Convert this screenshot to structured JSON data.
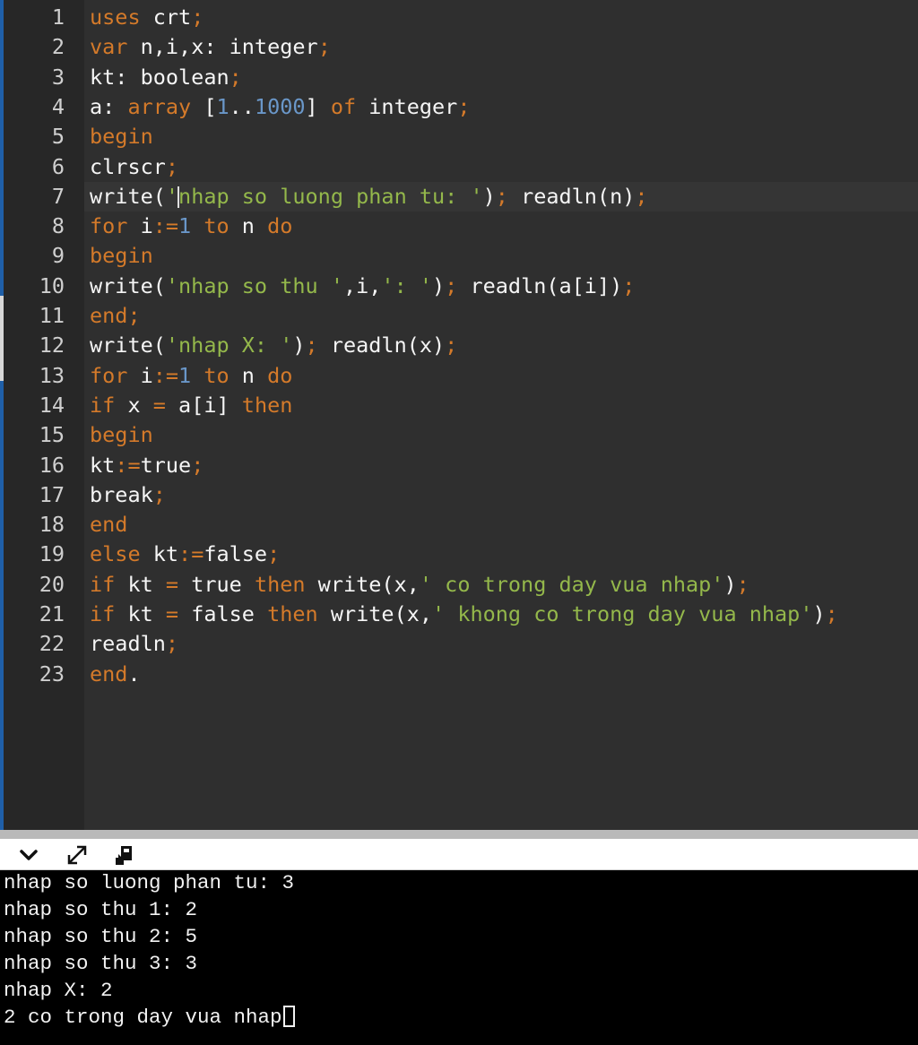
{
  "editor": {
    "line_numbers": [
      "1",
      "2",
      "3",
      "4",
      "5",
      "6",
      "7",
      "8",
      "9",
      "10",
      "11",
      "12",
      "13",
      "14",
      "15",
      "16",
      "17",
      "18",
      "19",
      "20",
      "21",
      "22",
      "23"
    ],
    "active_line": 7,
    "lines": [
      [
        [
          "kw",
          "uses"
        ],
        [
          "id",
          " crt"
        ],
        [
          "pn",
          ";"
        ]
      ],
      [
        [
          "kw",
          "var"
        ],
        [
          "id",
          " n,i,x: integer"
        ],
        [
          "pn",
          ";"
        ]
      ],
      [
        [
          "id",
          "kt: boolean"
        ],
        [
          "pn",
          ";"
        ]
      ],
      [
        [
          "id",
          "a: "
        ],
        [
          "kw",
          "array"
        ],
        [
          "id",
          " ["
        ],
        [
          "num",
          "1"
        ],
        [
          "id",
          ".."
        ],
        [
          "num",
          "1000"
        ],
        [
          "id",
          "] "
        ],
        [
          "kw",
          "of"
        ],
        [
          "id",
          " integer"
        ],
        [
          "pn",
          ";"
        ]
      ],
      [
        [
          "kw",
          "begin"
        ]
      ],
      [
        [
          "id",
          "clrscr"
        ],
        [
          "pn",
          ";"
        ]
      ],
      [
        [
          "id",
          "write("
        ],
        [
          "str",
          "'"
        ],
        [
          "caret",
          ""
        ],
        [
          "str",
          "nhap so luong phan tu: '"
        ],
        [
          "id",
          ")"
        ],
        [
          "pn",
          ";"
        ],
        [
          "id",
          " readln(n)"
        ],
        [
          "pn",
          ";"
        ]
      ],
      [
        [
          "kw",
          "for"
        ],
        [
          "id",
          " i"
        ],
        [
          "pn",
          ":="
        ],
        [
          "num",
          "1"
        ],
        [
          "kw",
          " to"
        ],
        [
          "id",
          " n "
        ],
        [
          "kw",
          "do"
        ]
      ],
      [
        [
          "kw",
          "begin"
        ]
      ],
      [
        [
          "id",
          "write("
        ],
        [
          "str",
          "'nhap so thu '"
        ],
        [
          "id",
          ",i,"
        ],
        [
          "str",
          "': '"
        ],
        [
          "id",
          ")"
        ],
        [
          "pn",
          ";"
        ],
        [
          "id",
          " readln(a[i])"
        ],
        [
          "pn",
          ";"
        ]
      ],
      [
        [
          "kw",
          "end"
        ],
        [
          "pn",
          ";"
        ]
      ],
      [
        [
          "id",
          "write("
        ],
        [
          "str",
          "'nhap X: '"
        ],
        [
          "id",
          ")"
        ],
        [
          "pn",
          ";"
        ],
        [
          "id",
          " readln(x)"
        ],
        [
          "pn",
          ";"
        ]
      ],
      [
        [
          "kw",
          "for"
        ],
        [
          "id",
          " i"
        ],
        [
          "pn",
          ":="
        ],
        [
          "num",
          "1"
        ],
        [
          "kw",
          " to"
        ],
        [
          "id",
          " n "
        ],
        [
          "kw",
          "do"
        ]
      ],
      [
        [
          "kw",
          "if"
        ],
        [
          "id",
          " x "
        ],
        [
          "pn",
          "="
        ],
        [
          "id",
          " a[i] "
        ],
        [
          "kw",
          "then"
        ]
      ],
      [
        [
          "kw",
          "begin"
        ]
      ],
      [
        [
          "id",
          "kt"
        ],
        [
          "pn",
          ":="
        ],
        [
          "id",
          "true"
        ],
        [
          "pn",
          ";"
        ]
      ],
      [
        [
          "id",
          "break"
        ],
        [
          "pn",
          ";"
        ]
      ],
      [
        [
          "kw",
          "end"
        ]
      ],
      [
        [
          "kw",
          "else"
        ],
        [
          "id",
          " kt"
        ],
        [
          "pn",
          ":="
        ],
        [
          "id",
          "false"
        ],
        [
          "pn",
          ";"
        ]
      ],
      [
        [
          "kw",
          "if"
        ],
        [
          "id",
          " kt "
        ],
        [
          "pn",
          "="
        ],
        [
          "id",
          " true "
        ],
        [
          "kw",
          "then"
        ],
        [
          "id",
          " write(x,"
        ],
        [
          "str",
          "' co trong day vua nhap'"
        ],
        [
          "id",
          ")"
        ],
        [
          "pn",
          ";"
        ]
      ],
      [
        [
          "kw",
          "if"
        ],
        [
          "id",
          " kt "
        ],
        [
          "pn",
          "="
        ],
        [
          "id",
          " false "
        ],
        [
          "kw",
          "then"
        ],
        [
          "id",
          " write(x,"
        ],
        [
          "str",
          "' khong co trong day vua nhap'"
        ],
        [
          "id",
          ")"
        ],
        [
          "pn",
          ";"
        ]
      ],
      [
        [
          "id",
          "readln"
        ],
        [
          "pn",
          ";"
        ]
      ],
      [
        [
          "kw",
          "end"
        ],
        [
          "id",
          "."
        ]
      ]
    ]
  },
  "toolbar": {
    "icons": [
      "chevron-down-icon",
      "expand-icon",
      "run-icon"
    ]
  },
  "console": {
    "lines": [
      "nhap so luong phan tu: 3",
      "nhap so thu 1: 2",
      "nhap so thu 2: 5",
      "nhap so thu 3: 3",
      "nhap X: 2",
      "2 co trong day vua nhap"
    ]
  },
  "colors": {
    "keyword": "#d47a2a",
    "string": "#94b84b",
    "number": "#6a97c9",
    "identifier": "#f5f5f5",
    "editor_bg": "#2f2f2f",
    "gutter_bg": "#272727",
    "console_bg": "#000000"
  }
}
